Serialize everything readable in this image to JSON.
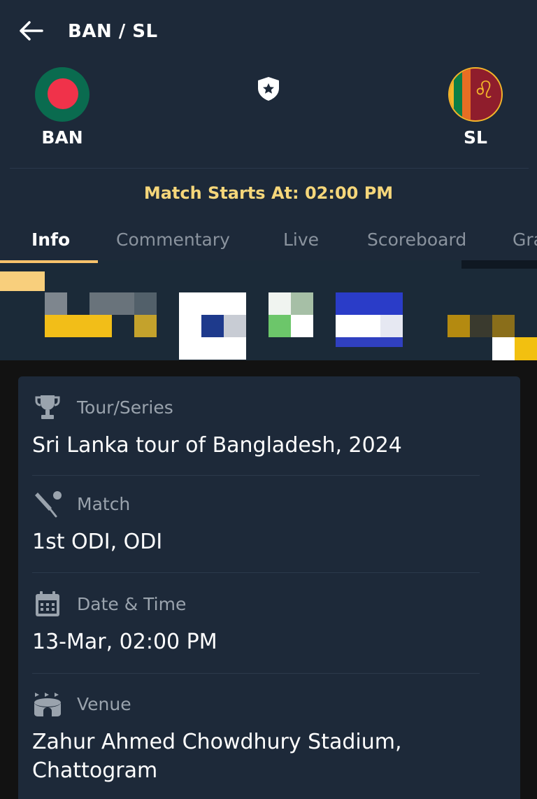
{
  "header": {
    "title": "BAN / SL",
    "match_start": "Match Starts At: 02:00 PM",
    "teams": [
      {
        "name": "BAN",
        "flag_icon": "bangladesh-flag-icon"
      },
      {
        "name": "SL",
        "flag_icon": "sri-lanka-flag-icon"
      }
    ]
  },
  "tabs": [
    {
      "label": "Info",
      "active": true
    },
    {
      "label": "Commentary"
    },
    {
      "label": "Live"
    },
    {
      "label": "Scoreboard"
    },
    {
      "label": "Gra"
    }
  ],
  "info": {
    "series": {
      "label": "Tour/Series",
      "value": "Sri Lanka tour of Bangladesh, 2024",
      "icon": "trophy-icon"
    },
    "match": {
      "label": "Match",
      "value": "1st ODI, ODI",
      "icon": "cricket-bat-icon"
    },
    "datetime": {
      "label": "Date & Time",
      "value": "13-Mar, 02:00 PM",
      "icon": "calendar-icon"
    },
    "venue": {
      "label": "Venue",
      "value": "Zahur Ahmed Chowdhury Stadium, Chattogram",
      "icon": "stadium-icon"
    }
  },
  "colors": {
    "background": "#121212",
    "header": "#1d2939",
    "card": "#1d2939",
    "accent": "#f5d67a",
    "muted": "#8a939e"
  }
}
